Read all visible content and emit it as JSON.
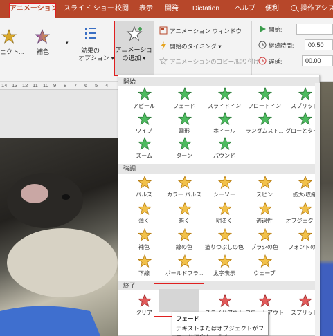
{
  "tabs": [
    {
      "label": "アニメーション",
      "active": true
    },
    {
      "label": "スライド ショー"
    },
    {
      "label": "校閲"
    },
    {
      "label": "表示"
    },
    {
      "label": "開発"
    },
    {
      "label": "Dictation"
    },
    {
      "label": "ヘルプ"
    },
    {
      "label": "便利"
    }
  ],
  "search": {
    "label": "操作アシス"
  },
  "ribbon": {
    "effect_partial": "ェクト...",
    "effect_complement": "補色",
    "effect_options": "効果の",
    "effect_options2": "オプション ▾",
    "add_animation": "アニメーション",
    "add_animation2": "の追加 ▾",
    "animation_window": "アニメーション ウィンドウ",
    "trigger": "開始のタイミング ▾",
    "animation_painter": "アニメーションのコピー/貼り付け",
    "start_label": "開始:",
    "duration_label": "継続時間:",
    "duration_value": "00.50",
    "delay_label": "遅延:",
    "delay_value": "00.00"
  },
  "ruler": [
    "14",
    "13",
    "12",
    "11",
    "10",
    "9",
    "8",
    "7",
    "6",
    "5",
    "4"
  ],
  "gallery": {
    "sections": {
      "entrance": "開始",
      "emphasis": "強調",
      "exit": "終了"
    },
    "entrance": [
      "アピール",
      "フェード",
      "スライドイン",
      "フロートイン",
      "スプリット",
      "ワイプ",
      "図形",
      "ホイール",
      "ランダムスト...",
      "グローとターン",
      "ズーム",
      "ターン",
      "バウンド"
    ],
    "emphasis": [
      "パルス",
      "カラー パルス",
      "シーソー",
      "スピン",
      "拡大/収縮",
      "薄く",
      "暗く",
      "明るく",
      "透過性",
      "オブジェクト...",
      "補色",
      "線の色",
      "塗りつぶしの色",
      "ブラシの色",
      "フォントの色",
      "下線",
      "ボールドフラ...",
      "太字表示",
      "ウェーブ"
    ],
    "exit": [
      "クリア",
      "フェード",
      "スライドアウト",
      "フロートアウト",
      "スプリット"
    ]
  },
  "tooltip": {
    "title": "フェード",
    "body": "テキストまたはオブジェクトがフェードアウトします"
  },
  "colors": {
    "accent": "#b7472a",
    "highlight": "#e02020",
    "entrance_green": "#3a9b4b",
    "emphasis_gold": "#e6a521",
    "exit_red": "#d23c3c"
  }
}
